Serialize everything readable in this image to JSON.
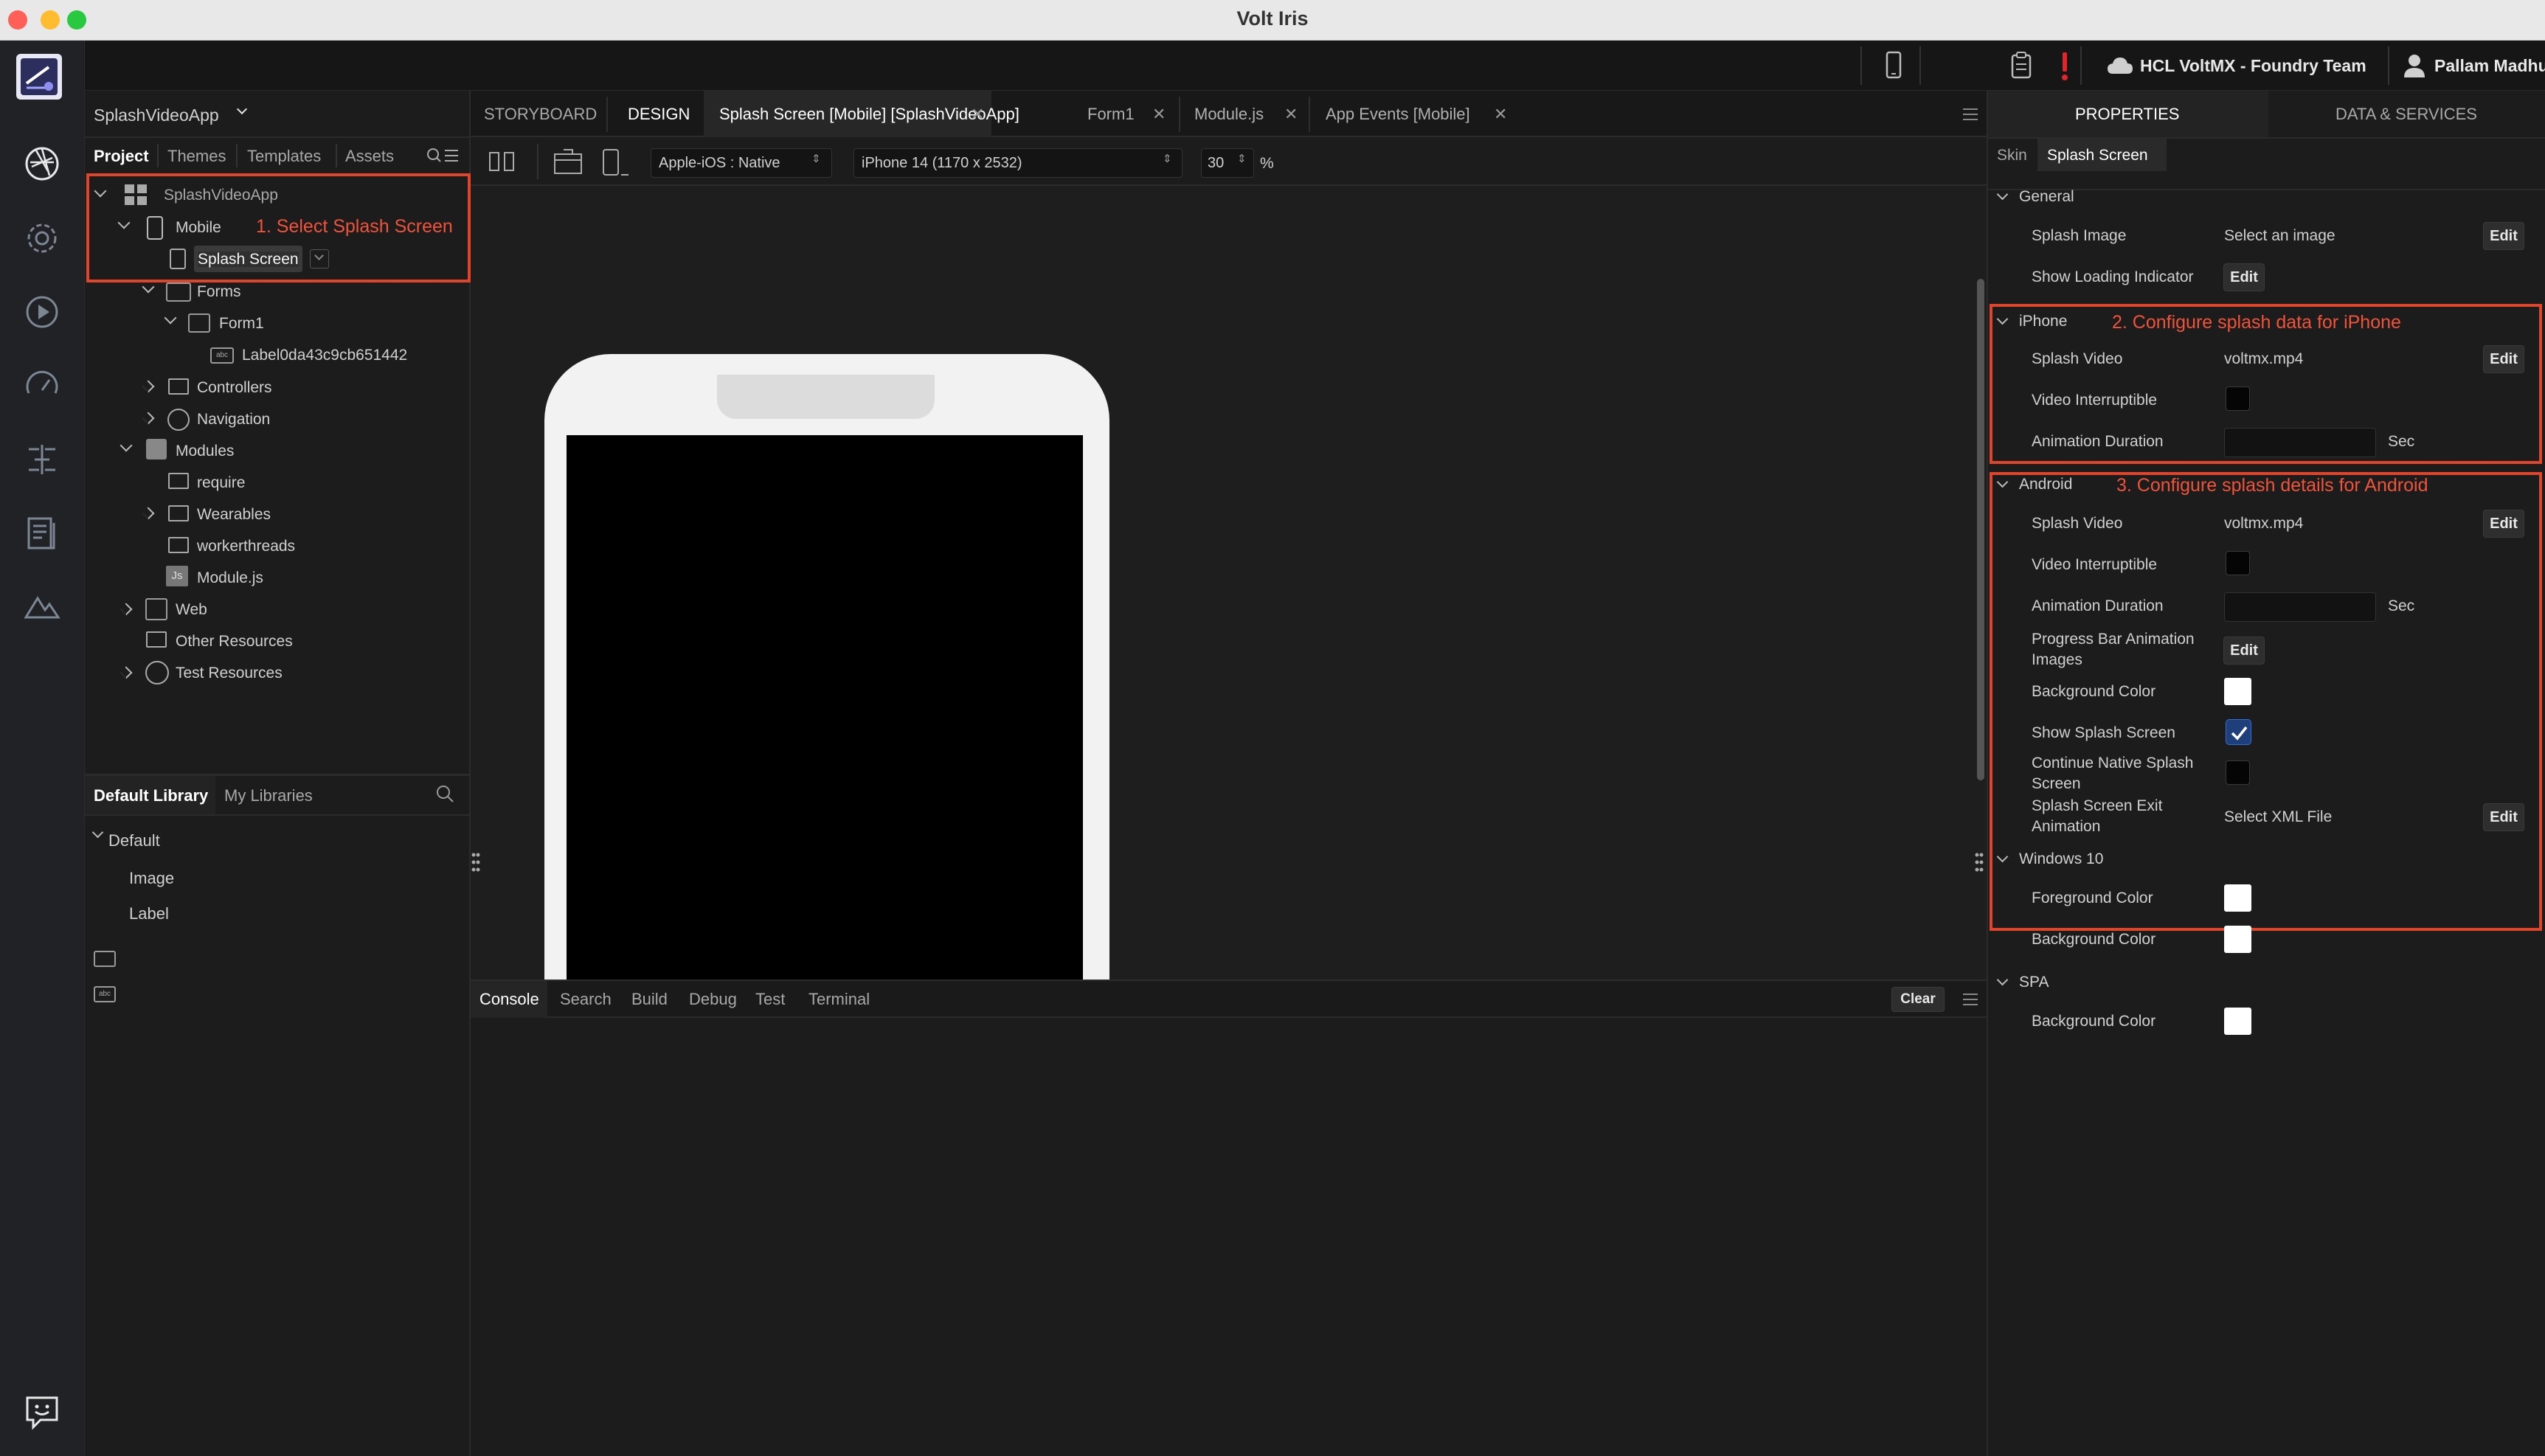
{
  "window": {
    "title": "Volt Iris"
  },
  "topbar": {
    "team": "HCL VoltMX - Foundry Team",
    "user": "Pallam Madhukar"
  },
  "project_selector": "SplashVideoApp",
  "left_tabs": [
    "Project",
    "Themes",
    "Templates",
    "Assets"
  ],
  "tree": {
    "root": "SplashVideoApp",
    "mobile": "Mobile",
    "splash": "Splash Screen",
    "forms": "Forms",
    "form1": "Form1",
    "label": "Label0da43c9cb651442",
    "controllers": "Controllers",
    "navigation": "Navigation",
    "modules": "Modules",
    "require": "require",
    "wearables": "Wearables",
    "workerthreads": "workerthreads",
    "modulejs": "Module.js",
    "web": "Web",
    "other": "Other Resources",
    "test": "Test Resources",
    "js_badge": "Js"
  },
  "annotations": {
    "a1": "1. Select Splash Screen",
    "a2": "2. Configure splash data for iPhone",
    "a3": "3. Configure splash details for Android"
  },
  "library": {
    "tabs": [
      "Default Library",
      "My Libraries"
    ],
    "group": "Default",
    "items": [
      "Image",
      "Label"
    ]
  },
  "editor_tabs": [
    "STORYBOARD",
    "DESIGN",
    "Splash Screen [Mobile] [SplashVideoApp]",
    "Form1",
    "Module.js",
    "App Events [Mobile]"
  ],
  "toolbar": {
    "platform": "Apple-iOS : Native",
    "device": "iPhone 14 (1170 x 2532)",
    "zoom": "30",
    "zoom_unit": "%"
  },
  "bottom_tabs": [
    "Console",
    "Search",
    "Build",
    "Debug",
    "Test",
    "Terminal"
  ],
  "clear_label": "Clear",
  "right_tabs": [
    "PROPERTIES",
    "DATA & SERVICES"
  ],
  "sub_tabs": [
    "Skin",
    "Splash Screen"
  ],
  "props": {
    "edit": "Edit",
    "sec": "Sec",
    "general": "General",
    "splash_image": "Splash Image",
    "select_image": "Select an image",
    "show_loading": "Show Loading Indicator",
    "iphone": "iPhone",
    "splash_video": "Splash Video",
    "video_file": "voltmx.mp4",
    "video_interruptible": "Video Interruptible",
    "animation_duration": "Animation Duration",
    "android": "Android",
    "progress_bar_1": "Progress Bar Animation",
    "progress_bar_2": "Images",
    "background_color": "Background Color",
    "show_splash": "Show Splash Screen",
    "continue_native_1": "Continue Native Splash",
    "continue_native_2": "Screen",
    "exit_anim_1": "Splash Screen Exit",
    "exit_anim_2": "Animation",
    "select_xml": "Select XML File",
    "windows": "Windows 10",
    "foreground_color": "Foreground Color",
    "spa": "SPA"
  },
  "colors": {
    "annotation": "#e0452c",
    "checkbox": "#2f6fd6"
  }
}
